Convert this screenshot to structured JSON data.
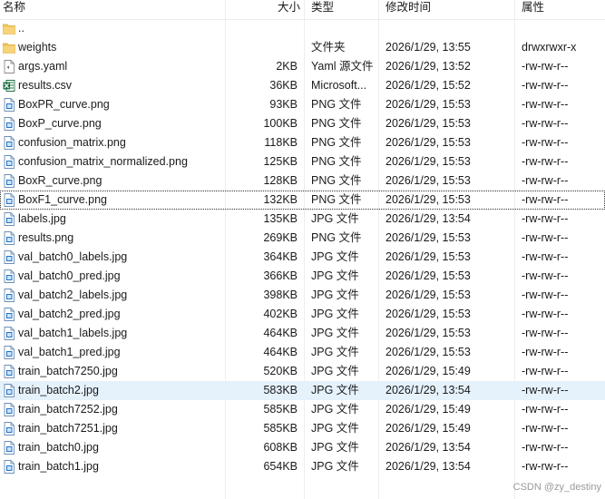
{
  "header": {
    "name": "名称",
    "size": "大小",
    "type": "类型",
    "modified": "修改时间",
    "permissions": "属性",
    "sort_indicator": "^"
  },
  "files": [
    {
      "name": "..",
      "size": "",
      "type": "",
      "modified": "",
      "permissions": "",
      "icon": "folder-icon"
    },
    {
      "name": "weights",
      "size": "",
      "type": "文件夹",
      "modified": "2026/1/29, 13:55",
      "permissions": "drwxrwxr-x",
      "icon": "folder-icon"
    },
    {
      "name": "args.yaml",
      "size": "2KB",
      "type": "Yaml 源文件",
      "modified": "2026/1/29, 13:52",
      "permissions": "-rw-rw-r--",
      "icon": "text-file-icon"
    },
    {
      "name": "results.csv",
      "size": "36KB",
      "type": "Microsoft...",
      "modified": "2026/1/29, 15:52",
      "permissions": "-rw-rw-r--",
      "icon": "excel-file-icon"
    },
    {
      "name": "BoxPR_curve.png",
      "size": "93KB",
      "type": "PNG 文件",
      "modified": "2026/1/29, 15:53",
      "permissions": "-rw-rw-r--",
      "icon": "image-file-icon"
    },
    {
      "name": "BoxP_curve.png",
      "size": "100KB",
      "type": "PNG 文件",
      "modified": "2026/1/29, 15:53",
      "permissions": "-rw-rw-r--",
      "icon": "image-file-icon"
    },
    {
      "name": "confusion_matrix.png",
      "size": "118KB",
      "type": "PNG 文件",
      "modified": "2026/1/29, 15:53",
      "permissions": "-rw-rw-r--",
      "icon": "image-file-icon"
    },
    {
      "name": "confusion_matrix_normalized.png",
      "size": "125KB",
      "type": "PNG 文件",
      "modified": "2026/1/29, 15:53",
      "permissions": "-rw-rw-r--",
      "icon": "image-file-icon"
    },
    {
      "name": "BoxR_curve.png",
      "size": "128KB",
      "type": "PNG 文件",
      "modified": "2026/1/29, 15:53",
      "permissions": "-rw-rw-r--",
      "icon": "image-file-icon"
    },
    {
      "name": "BoxF1_curve.png",
      "size": "132KB",
      "type": "PNG 文件",
      "modified": "2026/1/29, 15:53",
      "permissions": "-rw-rw-r--",
      "icon": "image-file-icon",
      "focused": true
    },
    {
      "name": "labels.jpg",
      "size": "135KB",
      "type": "JPG 文件",
      "modified": "2026/1/29, 13:54",
      "permissions": "-rw-rw-r--",
      "icon": "image-file-icon"
    },
    {
      "name": "results.png",
      "size": "269KB",
      "type": "PNG 文件",
      "modified": "2026/1/29, 15:53",
      "permissions": "-rw-rw-r--",
      "icon": "image-file-icon"
    },
    {
      "name": "val_batch0_labels.jpg",
      "size": "364KB",
      "type": "JPG 文件",
      "modified": "2026/1/29, 15:53",
      "permissions": "-rw-rw-r--",
      "icon": "image-file-icon"
    },
    {
      "name": "val_batch0_pred.jpg",
      "size": "366KB",
      "type": "JPG 文件",
      "modified": "2026/1/29, 15:53",
      "permissions": "-rw-rw-r--",
      "icon": "image-file-icon"
    },
    {
      "name": "val_batch2_labels.jpg",
      "size": "398KB",
      "type": "JPG 文件",
      "modified": "2026/1/29, 15:53",
      "permissions": "-rw-rw-r--",
      "icon": "image-file-icon"
    },
    {
      "name": "val_batch2_pred.jpg",
      "size": "402KB",
      "type": "JPG 文件",
      "modified": "2026/1/29, 15:53",
      "permissions": "-rw-rw-r--",
      "icon": "image-file-icon"
    },
    {
      "name": "val_batch1_labels.jpg",
      "size": "464KB",
      "type": "JPG 文件",
      "modified": "2026/1/29, 15:53",
      "permissions": "-rw-rw-r--",
      "icon": "image-file-icon"
    },
    {
      "name": "val_batch1_pred.jpg",
      "size": "464KB",
      "type": "JPG 文件",
      "modified": "2026/1/29, 15:53",
      "permissions": "-rw-rw-r--",
      "icon": "image-file-icon"
    },
    {
      "name": "train_batch7250.jpg",
      "size": "520KB",
      "type": "JPG 文件",
      "modified": "2026/1/29, 15:49",
      "permissions": "-rw-rw-r--",
      "icon": "image-file-icon"
    },
    {
      "name": "train_batch2.jpg",
      "size": "583KB",
      "type": "JPG 文件",
      "modified": "2026/1/29, 13:54",
      "permissions": "-rw-rw-r--",
      "icon": "image-file-icon",
      "selected": true
    },
    {
      "name": "train_batch7252.jpg",
      "size": "585KB",
      "type": "JPG 文件",
      "modified": "2026/1/29, 15:49",
      "permissions": "-rw-rw-r--",
      "icon": "image-file-icon"
    },
    {
      "name": "train_batch7251.jpg",
      "size": "585KB",
      "type": "JPG 文件",
      "modified": "2026/1/29, 15:49",
      "permissions": "-rw-rw-r--",
      "icon": "image-file-icon"
    },
    {
      "name": "train_batch0.jpg",
      "size": "608KB",
      "type": "JPG 文件",
      "modified": "2026/1/29, 13:54",
      "permissions": "-rw-rw-r--",
      "icon": "image-file-icon"
    },
    {
      "name": "train_batch1.jpg",
      "size": "654KB",
      "type": "JPG 文件",
      "modified": "2026/1/29, 13:54",
      "permissions": "-rw-rw-r--",
      "icon": "image-file-icon"
    }
  ],
  "watermark": "CSDN @zy_destiny",
  "colors": {
    "folder": "#f2c55c",
    "file_icon_accent": "#1e73c8",
    "excel": "#1d7044",
    "selection": "#e5f1fb"
  }
}
